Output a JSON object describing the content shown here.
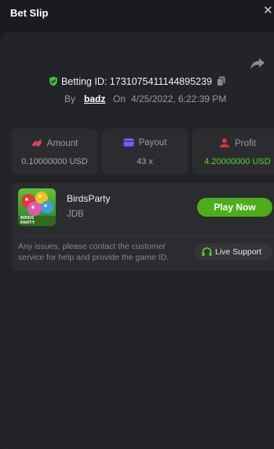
{
  "header": {
    "title": "Bet Slip",
    "close_glyph": "✕"
  },
  "bet": {
    "id_label": "Betting ID: 1731075411144895239",
    "by_label": "By",
    "username": "badz",
    "on_label": "On",
    "datetime": "4/25/2022, 6:22:39 PM"
  },
  "stats": [
    {
      "label": "Amount",
      "value": "0.10000000 USD",
      "icon": "amount-icon"
    },
    {
      "label": "Payout",
      "value": "43 x",
      "icon": "payout-card-icon"
    },
    {
      "label": "Profit",
      "value": "4.20000000 USD",
      "icon": "profit-icon"
    }
  ],
  "game": {
    "name": "BirdsParty",
    "provider": "JDB",
    "thumbnail_text": "BIRDS PARTY",
    "play_label": "Play Now",
    "notice": "Any issues, please contact the customer service for help and provide the game ID.",
    "support_label": "Live Support"
  },
  "colors": {
    "accent_green": "#4cae1a",
    "profit_green": "#5ed325",
    "amount_icon": "#e0425a",
    "payout_icon": "#7a5cff",
    "profit_icon": "#e0323a"
  }
}
